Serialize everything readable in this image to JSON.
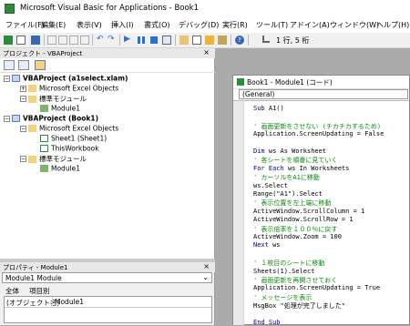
{
  "window": {
    "title": "Microsoft Visual Basic for Applications - Book1"
  },
  "menu": [
    "ファイル(F)",
    "編集(E)",
    "表示(V)",
    "挿入(I)",
    "書式(O)",
    "デバッグ(D)",
    "実行(R)",
    "ツール(T)",
    "アドイン(A)",
    "ウィンドウ(W)",
    "ヘルプ(H)"
  ],
  "toolbar": {
    "position": "1 行, 5 桁"
  },
  "project": {
    "header": "プロジェクト - VBAProject",
    "close": "×",
    "tree": [
      {
        "label": "VBAProject (a1select.xlam)",
        "bold": true
      },
      {
        "label": "Microsoft Excel Objects",
        "bold": false
      },
      {
        "label": "標準モジュール",
        "bold": false
      },
      {
        "label": "Module1",
        "bold": false
      },
      {
        "label": "VBAProject (Book1)",
        "bold": true
      },
      {
        "label": "Microsoft Excel Objects",
        "bold": false
      },
      {
        "label": "Sheet1 (Sheet1)",
        "bold": false
      },
      {
        "label": "ThisWorkbook",
        "bold": false
      },
      {
        "label": "標準モジュール",
        "bold": false
      },
      {
        "label": "Module1",
        "bold": false
      }
    ]
  },
  "properties": {
    "header": "プロパティ - Module1",
    "close": "×",
    "object": "Module1  Module",
    "tabs": [
      "全体",
      "項目別"
    ],
    "grid": {
      "key": "(オブジェクト名)",
      "value": "Module1"
    }
  },
  "code_window": {
    "title": "Book1 - Module1 (コード)",
    "combo": "(General)",
    "lines": [
      {
        "kw": "Sub ",
        "tx": "A1()",
        "cm": ""
      },
      {
        "kw": "",
        "tx": "",
        "cm": ""
      },
      {
        "kw": "",
        "tx": "",
        "cm": "' 画面更新をさせない (チカチカするため)"
      },
      {
        "kw": "",
        "tx": "Application.ScreenUpdating = False",
        "cm": ""
      },
      {
        "kw": "",
        "tx": "",
        "cm": ""
      },
      {
        "kw": "Dim ",
        "tx": "ws As Worksheet",
        "cm": ""
      },
      {
        "kw": "",
        "tx": "",
        "cm": "' 各シートを順番に見ていく"
      },
      {
        "kw": "For Each ",
        "tx": "ws In Worksheets",
        "cm": ""
      },
      {
        "kw": "",
        "tx": "",
        "cm": "' カーソルをA1に移動"
      },
      {
        "kw": "",
        "tx": "ws.Select",
        "cm": ""
      },
      {
        "kw": "",
        "tx": "Range(\"A1\").Select",
        "cm": ""
      },
      {
        "kw": "",
        "tx": "",
        "cm": "' 表示位置を左上端に移動"
      },
      {
        "kw": "",
        "tx": "ActiveWindow.ScrollColumn = 1",
        "cm": ""
      },
      {
        "kw": "",
        "tx": "ActiveWindow.ScrollRow = 1",
        "cm": ""
      },
      {
        "kw": "",
        "tx": "",
        "cm": "' 表示倍率を１００％に戻す"
      },
      {
        "kw": "",
        "tx": "ActiveWindow.Zoom = 100",
        "cm": ""
      },
      {
        "kw": "Next ",
        "tx": "ws",
        "cm": ""
      },
      {
        "kw": "",
        "tx": "",
        "cm": ""
      },
      {
        "kw": "",
        "tx": "",
        "cm": "' １枚目のシートに移動"
      },
      {
        "kw": "",
        "tx": "Sheets(1).Select",
        "cm": ""
      },
      {
        "kw": "",
        "tx": "",
        "cm": "' 画面更新を再開させておく"
      },
      {
        "kw": "",
        "tx": "Application.ScreenUpdating = True",
        "cm": ""
      },
      {
        "kw": "",
        "tx": "",
        "cm": "' メッセージを表示"
      },
      {
        "kw": "",
        "tx": "MsgBox \"処理が完了しました\"",
        "cm": ""
      },
      {
        "kw": "",
        "tx": "",
        "cm": ""
      },
      {
        "kw": "End Sub",
        "tx": "",
        "cm": ""
      }
    ]
  }
}
